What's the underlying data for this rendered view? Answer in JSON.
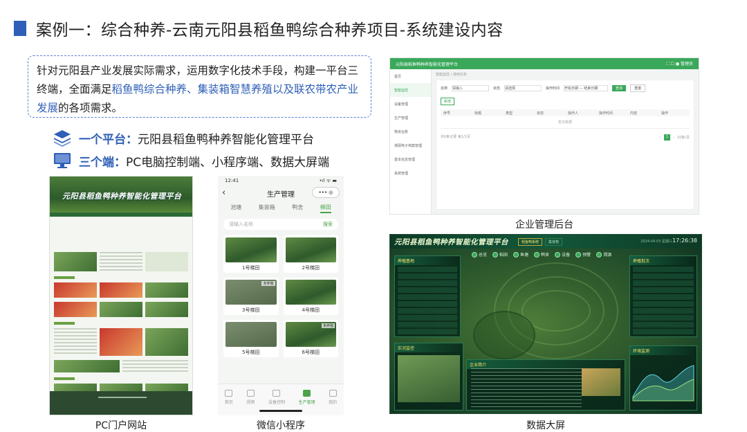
{
  "slide": {
    "title": "案例一：综合种养-云南元阳县稻鱼鸭综合种养项目-系统建设内容",
    "intro_part1": "针对元阳县产业发展实际需求，运用数字化技术手段，构建一平台三终端，全面满足",
    "intro_highlight": "稻鱼鸭综合种养、集装箱智慧养殖以及联农带农产业发展",
    "intro_part2": "的各项需求。",
    "platform_key": "一个平台：",
    "platform_text": "元阳县稻鱼鸭种养智能化管理平台",
    "terminals_key": "三个端：",
    "terminals_text": "PC电脑控制端、小程序端、数据大屏端",
    "accent_color": "#2f5fb6"
  },
  "captions": {
    "pc": "PC门户网站",
    "miniprogram": "微信小程序",
    "admin": "企业管理后台",
    "screen": "数据大屏"
  },
  "pc_portal": {
    "hero_title": "元阳县稻鱼鸭种养智能化管理平台"
  },
  "mobile": {
    "time": "12:41",
    "signal": "•ıl ᯤ ▬",
    "back_icon": "‹",
    "caps": "••• ◎",
    "header_title": "生产管理",
    "tabs": [
      "池塘",
      "集装箱",
      "鸭舍",
      "梯田"
    ],
    "active_tab": "梯田",
    "search_placeholder": "请输入名称",
    "search_button": "搜索",
    "cards": [
      {
        "label": "1号梯田",
        "tag": ""
      },
      {
        "label": "2号梯田",
        "tag": ""
      },
      {
        "label": "3号梯田",
        "tag": "未养殖"
      },
      {
        "label": "4号梯田",
        "tag": ""
      },
      {
        "label": "5号梯田",
        "tag": ""
      },
      {
        "label": "6号梯田",
        "tag": "未养殖"
      }
    ],
    "tabbar": [
      "首页",
      "视频",
      "设备控制",
      "生产管理",
      "我的"
    ],
    "tabbar_active": "生产管理"
  },
  "admin": {
    "app_title": "元阳县稻鱼鸭种养智能化管理平台",
    "top_right": "⛶ ☐ ● 管理员",
    "sidebar": [
      "首页",
      "智能监控",
      "设备管理",
      "生产管理",
      "物资台账",
      "溯源电子档案管理",
      "基本信息管理",
      "系统管理"
    ],
    "sidebar_active": "智能监控",
    "breadcrumb": "智能监控 / 通用任务",
    "filter_name_label": "名称",
    "filter_name_placeholder": "请输入",
    "filter_status_label": "状态",
    "filter_status_placeholder": "请选择",
    "filter_time_label": "操作时间",
    "filter_time_value": "开始日期 — 结束日期",
    "query_btn": "查询",
    "reset_btn": "重置",
    "add_btn": "新增",
    "columns": [
      "序号",
      "标题",
      "类型",
      "状态",
      "操作人",
      "操作时间",
      "内容",
      "操作"
    ],
    "empty": "暂无数据",
    "total": "共0条记录 第1/1页",
    "page": "1",
    "per_page": "10条/页"
  },
  "screen": {
    "title": "元阳县稻鱼鸭种养智能化管理平台",
    "header_tabs": [
      "稻鱼鸭系统",
      "集装箱"
    ],
    "date": "2024-04-03 星期三",
    "clock": "17:26:38",
    "nav_icons": [
      "总览",
      "稻田",
      "鱼塘",
      "鸭舍",
      "设备",
      "预警",
      "溯源"
    ],
    "left_panel_title": "养殖基地",
    "right_panel_title": "养殖批次",
    "left_bottom_title": "实况监控",
    "center_bottom_title": "企业简介",
    "right_bottom_title": "环境监测"
  }
}
